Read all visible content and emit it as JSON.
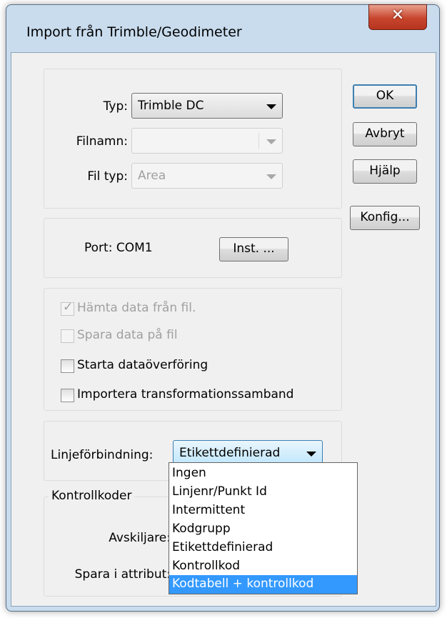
{
  "window": {
    "title": "Import från Trimble/Geodimeter",
    "close_glyph": "✕"
  },
  "file_group": {
    "typ_label": "Typ:",
    "typ_value": "Trimble DC",
    "filnamn_label": "Filnamn:",
    "filnamn_value": "",
    "filtyp_label": "Fil typ:",
    "filtyp_value": "Area"
  },
  "port_group": {
    "port_label": "Port: COM1",
    "inst_button": "Inst. ..."
  },
  "options": [
    {
      "label": "Hämta data från fil.",
      "checked": true,
      "enabled": false
    },
    {
      "label": "Spara data på fil",
      "checked": false,
      "enabled": false
    },
    {
      "label": "Starta dataöverföring",
      "checked": false,
      "enabled": true
    },
    {
      "label": "Importera transformationssamband",
      "checked": false,
      "enabled": true
    }
  ],
  "linje": {
    "label": "Linjeförbindning:",
    "value": "Etikettdefinierad"
  },
  "kontroll": {
    "group_title": "Kontrollkoder",
    "avskiljare_label": "Avskiljare:",
    "spara_label": "Spara i attribut:"
  },
  "dropdown_items": [
    "Ingen",
    "Linjenr/Punkt Id",
    "Intermittent",
    "Kodgrupp",
    "Etikettdefinierad",
    "Kontrollkod",
    "Kodtabell + kontrollkod"
  ],
  "selected_index": 6,
  "buttons": {
    "ok": "OK",
    "cancel": "Avbryt",
    "help": "Hjälp",
    "config": "Konfig..."
  },
  "colors": {
    "title_bg": "#c9dcee",
    "selection": "#3399ff",
    "close": "#c7452d"
  }
}
